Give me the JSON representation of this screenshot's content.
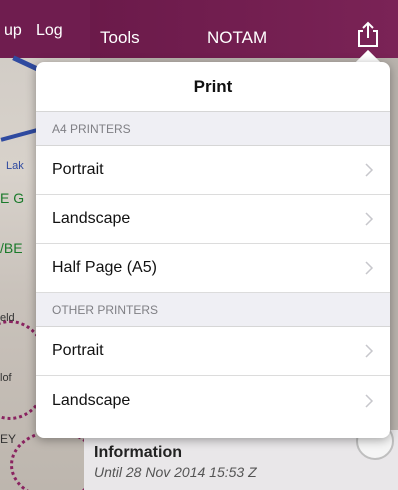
{
  "app_bar": {
    "left_labels": [
      "up",
      "Log"
    ],
    "tabs": [
      "Tools",
      "NOTAM"
    ],
    "share_icon": "share-icon"
  },
  "map_labels": [
    "Lak",
    "E G",
    "/BE",
    "eld",
    "lof",
    "EY"
  ],
  "print_popover": {
    "title": "Print",
    "sections": [
      {
        "header": "A4 PRINTERS",
        "items": [
          "Portrait",
          "Landscape",
          "Half Page (A5)"
        ]
      },
      {
        "header": "OTHER PRINTERS",
        "items": [
          "Portrait",
          "Landscape"
        ]
      }
    ]
  },
  "info_panel": {
    "title": "Information",
    "subtitle": "Until 28 Nov 2014 15:53 Z"
  },
  "colors": {
    "toolbar": "#6f1d4f",
    "section_bg": "#efeff4",
    "section_text": "#7f7f84"
  }
}
